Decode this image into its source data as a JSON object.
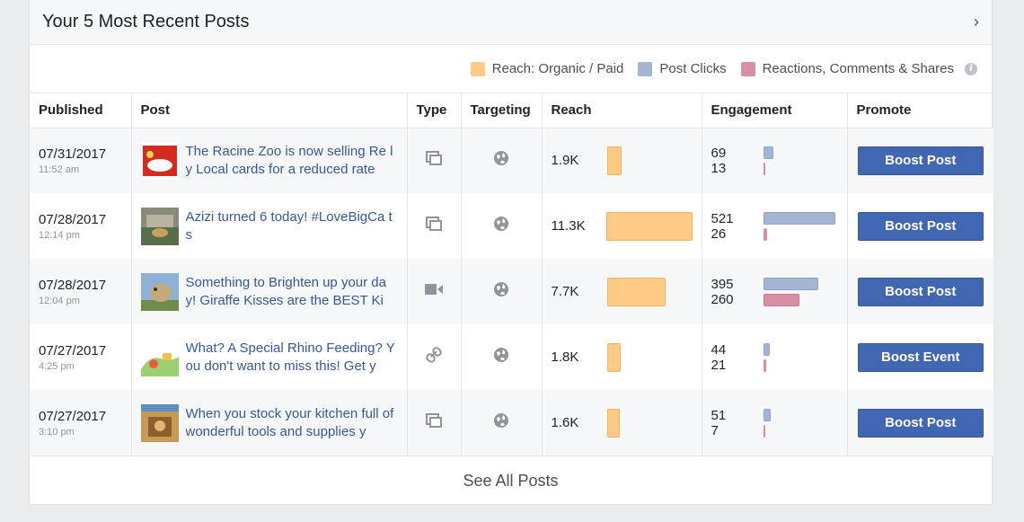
{
  "header": {
    "title": "Your 5 Most Recent Posts"
  },
  "legend": {
    "items": [
      {
        "label": "Reach: Organic / Paid",
        "color": "#ffca85"
      },
      {
        "label": "Post Clicks",
        "color": "#a4b4d3"
      },
      {
        "label": "Reactions, Comments & Shares",
        "color": "#d88ea4"
      }
    ]
  },
  "table": {
    "columns": [
      "Published",
      "Post",
      "Type",
      "Targeting",
      "Reach",
      "Engagement",
      "Promote"
    ],
    "rows": [
      {
        "date": "07/31/2017",
        "time": "11:52 am",
        "text": "The Racine Zoo is now selling Re ly Local cards for a reduced rate",
        "type": "photo",
        "targeting": "globe",
        "reach": "1.9K",
        "reach_value": 1900,
        "clicks": "69",
        "reactions": "13",
        "clicks_value": 69,
        "reactions_value": 13,
        "promote": "Boost Post"
      },
      {
        "date": "07/28/2017",
        "time": "12:14 pm",
        "text": "Azizi turned 6 today! #LoveBigCa ts",
        "type": "photo",
        "targeting": "globe",
        "reach": "11.3K",
        "reach_value": 11300,
        "clicks": "521",
        "reactions": "26",
        "clicks_value": 521,
        "reactions_value": 26,
        "promote": "Boost Post"
      },
      {
        "date": "07/28/2017",
        "time": "12:04 pm",
        "text": "Something to Brighten up your da y! Giraffe Kisses are the BEST Ki",
        "type": "video",
        "targeting": "globe",
        "reach": "7.7K",
        "reach_value": 7700,
        "clicks": "395",
        "reactions": "260",
        "clicks_value": 395,
        "reactions_value": 260,
        "promote": "Boost Post"
      },
      {
        "date": "07/27/2017",
        "time": "4:25 pm",
        "text": "What? A Special Rhino Feeding? You don't want to miss this! Get y",
        "type": "link",
        "targeting": "globe",
        "reach": "1.8K",
        "reach_value": 1800,
        "clicks": "44",
        "reactions": "21",
        "clicks_value": 44,
        "reactions_value": 21,
        "promote": "Boost Event"
      },
      {
        "date": "07/27/2017",
        "time": "3:10 pm",
        "text": "When you stock your kitchen full of wonderful tools and supplies y",
        "type": "photo",
        "targeting": "globe",
        "reach": "1.6K",
        "reach_value": 1600,
        "clicks": "51",
        "reactions": "7",
        "clicks_value": 51,
        "reactions_value": 7,
        "promote": "Boost Post"
      }
    ]
  },
  "footer": {
    "label": "See All Posts"
  }
}
